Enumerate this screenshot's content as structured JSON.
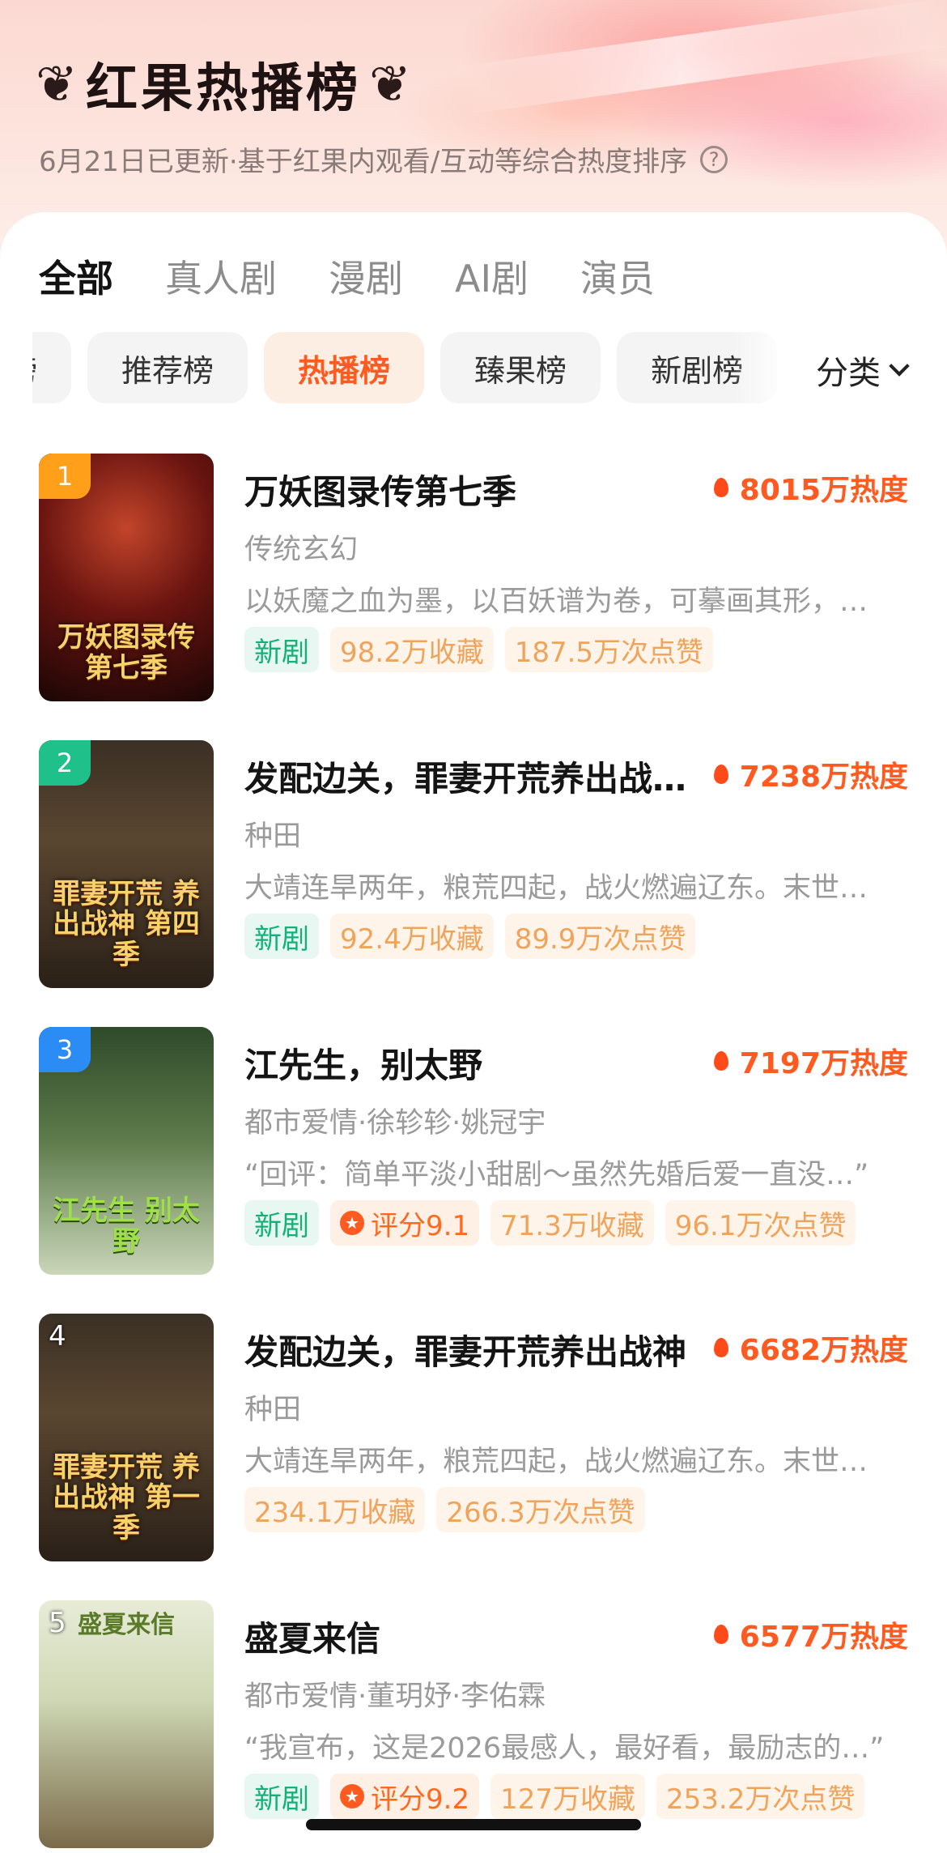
{
  "header": {
    "title": "红果热播榜",
    "subtitle": "6月21日已更新·基于红果内观看/互动等综合热度排序",
    "help_icon": "question-circle-icon"
  },
  "top_tabs": [
    {
      "label": "全部",
      "active": true
    },
    {
      "label": "真人剧",
      "active": false
    },
    {
      "label": "漫剧",
      "active": false
    },
    {
      "label": "AI剧",
      "active": false
    },
    {
      "label": "演员",
      "active": false
    }
  ],
  "chips": [
    {
      "label": "热门榜",
      "active": false
    },
    {
      "label": "推荐榜",
      "active": false
    },
    {
      "label": "热播榜",
      "active": true
    },
    {
      "label": "臻果榜",
      "active": false
    },
    {
      "label": "新剧榜",
      "active": false
    }
  ],
  "category_button": "分类",
  "colors": {
    "accent": "#ff5a1f",
    "new_tag": "#14b07a",
    "stat_tag": "#f0a35a",
    "rank1": "#ff9f1a",
    "rank2": "#1fc08a",
    "rank3": "#2b8cf5"
  },
  "items": [
    {
      "rank": "1",
      "poster_caption": "万妖图录传 第七季",
      "title": "万妖图录传第七季",
      "heat": "8015万热度",
      "genre": "传统玄幻",
      "desc": "以妖魔之血为墨，以百妖谱为卷，可摹画其形，…",
      "tags": [
        "新剧",
        "98.2万收藏",
        "187.5万次点赞"
      ],
      "rating": null
    },
    {
      "rank": "2",
      "poster_caption": "罪妻开荒 养出战神 第四季",
      "title": "发配边关，罪妻开荒养出战…",
      "heat": "7238万热度",
      "genre": "种田",
      "desc": "大靖连旱两年，粮荒四起，战火燃遍辽东。末世…",
      "tags": [
        "新剧",
        "92.4万收藏",
        "89.9万次点赞"
      ],
      "rating": null
    },
    {
      "rank": "3",
      "poster_caption": "江先生 别太野",
      "title": "江先生，别太野",
      "heat": "7197万热度",
      "genre": "都市爱情·徐轸轸·姚冠宇",
      "desc": "“回评：简单平淡小甜剧～虽然先婚后爱一直没…”",
      "tags": [
        "新剧",
        "71.3万收藏",
        "96.1万次点赞"
      ],
      "rating": "评分9.1"
    },
    {
      "rank": "4",
      "poster_caption": "罪妻开荒 养出战神 第一季",
      "title": "发配边关，罪妻开荒养出战神",
      "heat": "6682万热度",
      "genre": "种田",
      "desc": "大靖连旱两年，粮荒四起，战火燃遍辽东。末世…",
      "tags": [
        "234.1万收藏",
        "266.3万次点赞"
      ],
      "rating": null
    },
    {
      "rank": "5",
      "poster_caption": "盛夏来信",
      "title": "盛夏来信",
      "heat": "6577万热度",
      "genre": "都市爱情·董玥妤·李佑霖",
      "desc": "“我宣布，这是2026最感人，最好看，最励志的…”",
      "tags": [
        "新剧",
        "127万收藏",
        "253.2万次点赞"
      ],
      "rating": "评分9.2"
    }
  ]
}
